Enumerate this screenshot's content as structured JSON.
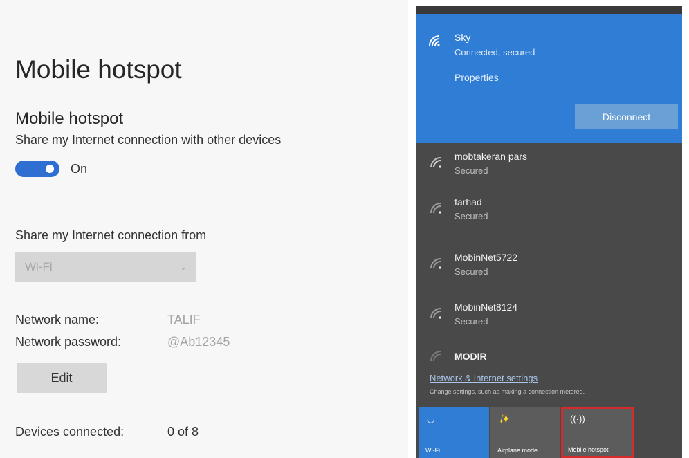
{
  "settings": {
    "page_title": "Mobile hotspot",
    "section_title": "Mobile hotspot",
    "description": "Share my Internet connection with other devices",
    "toggle_state": "On",
    "share_from_label": "Share my Internet connection from",
    "share_from_value": "Wi-Fi",
    "network_name_label": "Network name:",
    "network_name_value": "TALIF",
    "network_password_label": "Network password:",
    "network_password_value": "@Ab12345",
    "edit_label": "Edit",
    "devices_label": "Devices connected:",
    "devices_value": "0 of 8"
  },
  "flyout": {
    "active": {
      "name": "Sky",
      "status": "Connected, secured",
      "properties_label": "Properties",
      "disconnect_label": "Disconnect"
    },
    "networks": [
      {
        "name": "mobtakeran pars",
        "status": "Secured"
      },
      {
        "name": "farhad",
        "status": "Secured"
      },
      {
        "name": "MobinNet5722",
        "status": "Secured"
      },
      {
        "name": "MobinNet8124",
        "status": "Secured"
      },
      {
        "name": "MODIR",
        "status": ""
      }
    ],
    "settings_link": "Network & Internet settings",
    "settings_desc": "Change settings, such as making a connection metered.",
    "tiles": {
      "wifi": "Wi-Fi",
      "airplane": "Airplane mode",
      "hotspot": "Mobile hotspot"
    }
  },
  "colors": {
    "accent": "#2f7dd4",
    "toggle": "#2f6fd1",
    "highlight": "#d62b2b"
  }
}
